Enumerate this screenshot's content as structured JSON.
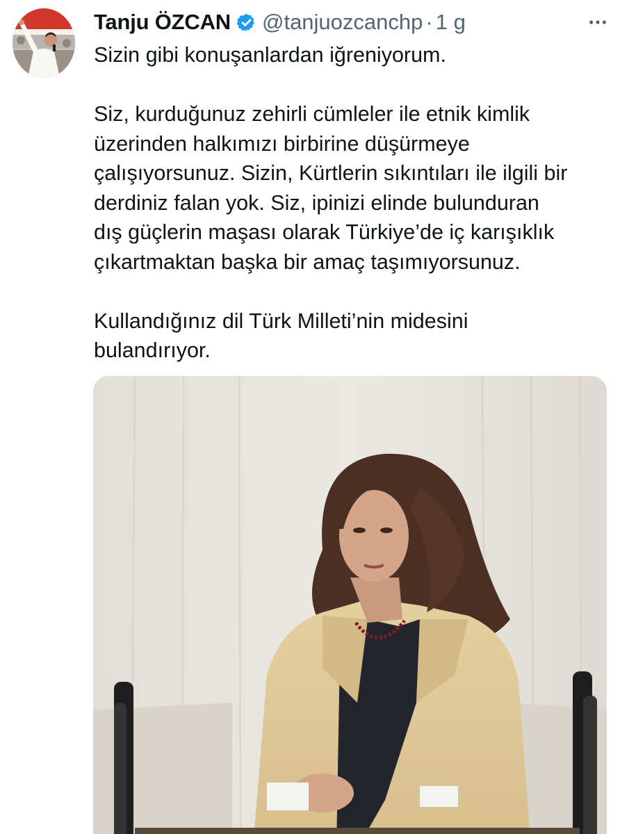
{
  "tweet": {
    "author": {
      "name": "Tanju ÖZCAN",
      "handle": "@tanjuozcanchp",
      "verified": true,
      "avatar_icon": "person-speaking-avatar"
    },
    "separator": "·",
    "time": "1 g",
    "more_icon": "ellipsis-icon",
    "text_paragraphs": [
      [
        "Sizin gibi konuşanlardan iğreniyorum."
      ],
      [
        "Siz, kurduğunuz zehirli cümleler ile etnik kimlik",
        "üzerinden halkımızı birbirine düşürmeye",
        "çalışıyorsunuz. Sizin, Kürtlerin sıkıntıları ile ilgili bir",
        "derdiniz falan yok. Siz, ipinizi elinde bulunduran",
        "dış güçlerin maşası olarak Türkiye’de iç karışıklık",
        "çıkartmaktan başka bir amaç taşımıyorsunuz."
      ],
      [
        "Kullandığınız dil Türk Milleti’nin midesini",
        "bulandırıyor."
      ]
    ],
    "media": {
      "type": "photo",
      "icon": "woman-speaking-at-podium-photo"
    }
  },
  "colors": {
    "text": "#0f1419",
    "secondary": "#536471",
    "verified": "#1d9bf0"
  }
}
